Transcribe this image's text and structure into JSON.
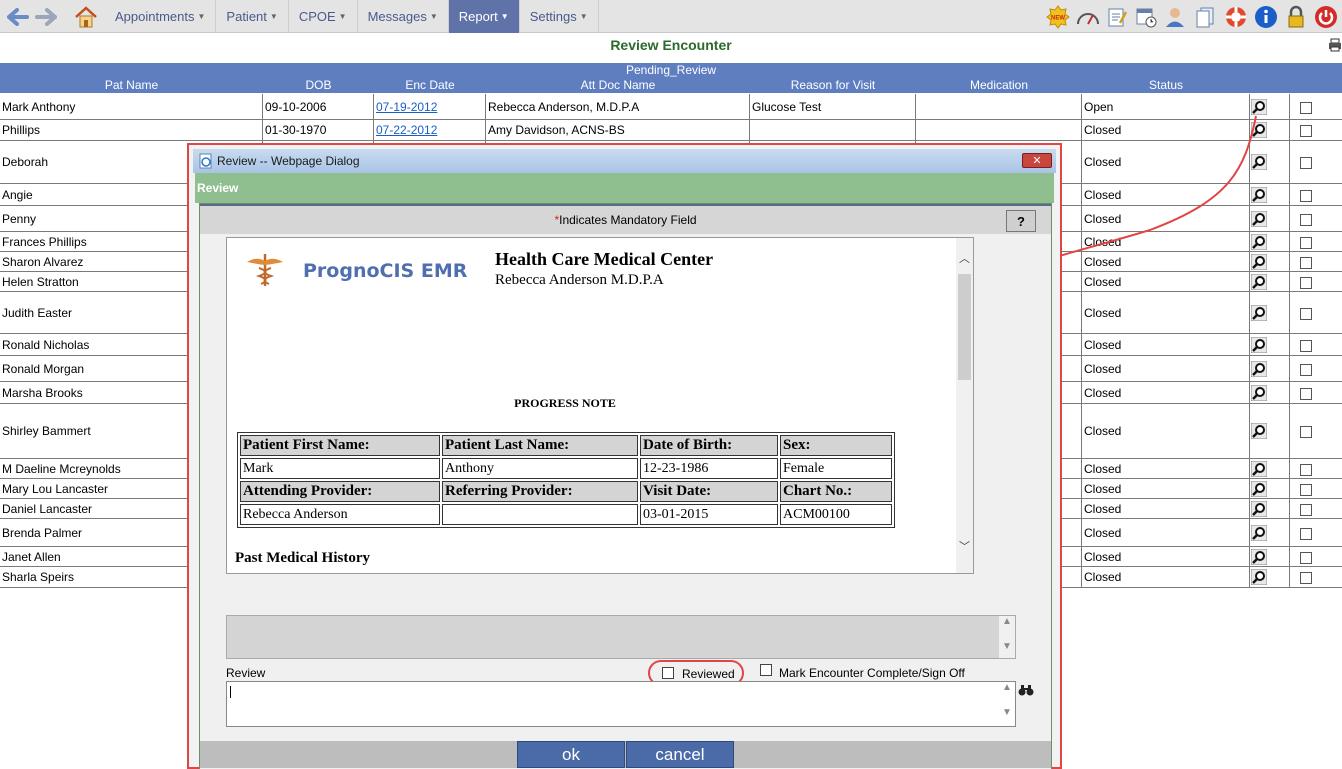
{
  "nav": {
    "menu": [
      {
        "label": "Appointments",
        "active": false
      },
      {
        "label": "Patient",
        "active": false
      },
      {
        "label": "CPOE",
        "active": false
      },
      {
        "label": "Messages",
        "active": false
      },
      {
        "label": "Report",
        "active": true
      },
      {
        "label": "Settings",
        "active": false
      }
    ],
    "new_badge": "NEW"
  },
  "page_title": "Review Encounter",
  "table": {
    "group_label": "Pending_Review",
    "headers": [
      "Pat Name",
      "DOB",
      "Enc Date",
      "Att Doc Name",
      "Reason for Visit",
      "Medication",
      "Status"
    ],
    "rows": [
      {
        "name": "Mark Anthony",
        "dob": "09-10-2006",
        "enc": "07-19-2012",
        "doc": "Rebecca Anderson, M.D.P.A",
        "reason": "Glucose Test",
        "status": "Open"
      },
      {
        "name": "Phillips",
        "dob": "01-30-1970",
        "enc": "07-22-2012",
        "doc": "Amy Davidson, ACNS-BS",
        "reason": "",
        "status": "Closed"
      },
      {
        "name": "Deborah",
        "status": "Closed"
      },
      {
        "name": "Angie",
        "status": "Closed"
      },
      {
        "name": "Penny",
        "status": "Closed"
      },
      {
        "name": "Frances Phillips",
        "status": "Closed"
      },
      {
        "name": "Sharon Alvarez",
        "status": "Closed"
      },
      {
        "name": "Helen Stratton",
        "status": "Closed"
      },
      {
        "name": "Judith Easter",
        "status": "Closed"
      },
      {
        "name": "Ronald Nicholas",
        "status": "Closed"
      },
      {
        "name": "Ronald Morgan",
        "status": "Closed"
      },
      {
        "name": "Marsha Brooks",
        "status": "Closed"
      },
      {
        "name": "Shirley Bammert",
        "status": "Closed"
      },
      {
        "name": "M Daeline Mcreynolds",
        "status": "Closed"
      },
      {
        "name": "Mary Lou Lancaster",
        "status": "Closed"
      },
      {
        "name": "Daniel Lancaster",
        "status": "Closed"
      },
      {
        "name": "Brenda Palmer",
        "status": "Closed"
      },
      {
        "name": "Janet Allen",
        "status": "Closed"
      },
      {
        "name": "Sharla Speirs",
        "status": "Closed"
      }
    ]
  },
  "dialog": {
    "title": "Review -- Webpage Dialog",
    "section": "Review",
    "mandatory_star": "*",
    "mandatory_text": "Indicates Mandatory Field",
    "help": "?",
    "logo_text": "PrognoCIS EMR",
    "org_name": "Health Care Medical Center",
    "doctor": "Rebecca Anderson M.D.P.A",
    "note_title": "PROGRESS NOTE",
    "patient_table": {
      "h1": [
        "Patient First Name:",
        "Patient Last Name:",
        "Date of Birth:",
        "Sex:"
      ],
      "r1": [
        "Mark",
        "Anthony",
        "12-23-1986",
        "Female"
      ],
      "h2": [
        "Attending Provider:",
        "Referring Provider:",
        "Visit Date:",
        "Chart No.:"
      ],
      "r2": [
        "Rebecca Anderson",
        "",
        "03-01-2015",
        "ACM00100"
      ]
    },
    "past_medical_history": "Past Medical History",
    "review_label": "Review",
    "reviewed_label": "Reviewed",
    "signoff_label": "Mark Encounter Complete/Sign Off",
    "ok_label": "ok",
    "cancel_label": "cancel"
  }
}
